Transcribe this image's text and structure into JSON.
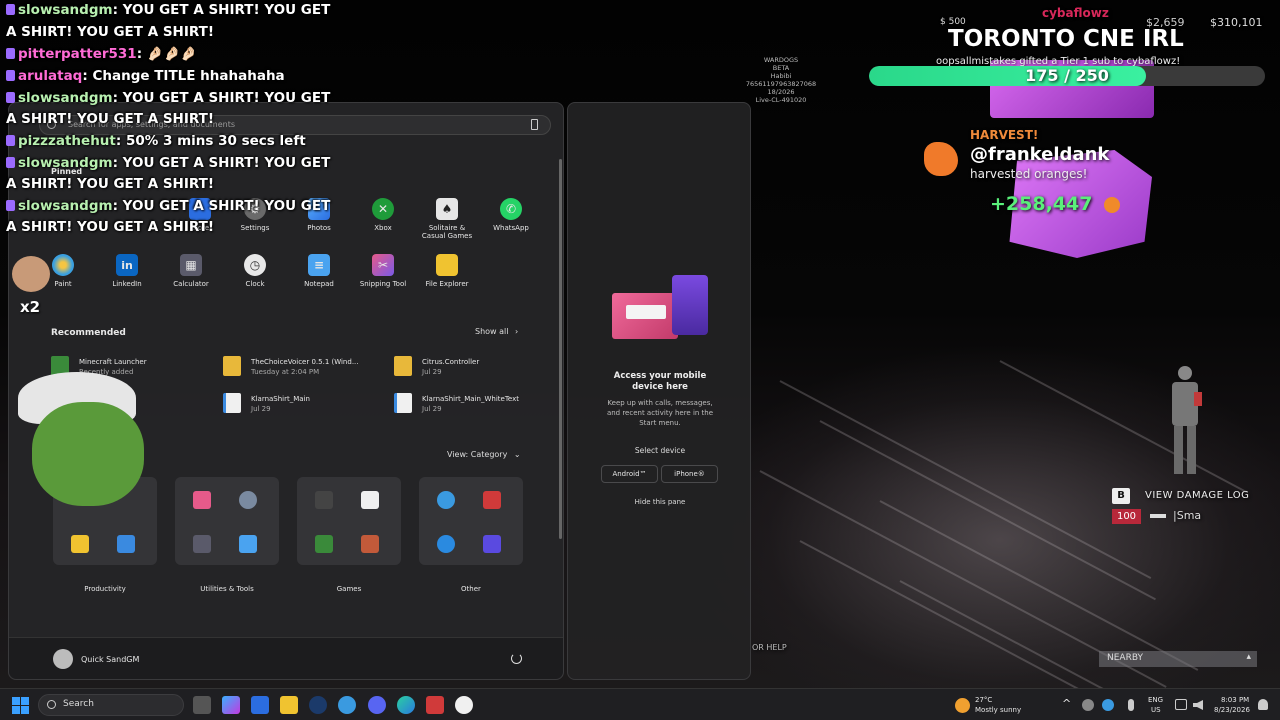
{
  "chat": {
    "messages": [
      {
        "user": "slowsandgm",
        "text": "YOU GET A SHIRT! YOU GET"
      },
      {
        "user": "",
        "text": "A SHIRT! YOU GET A SHIRT!"
      },
      {
        "user": "pitterpatter531",
        "text": "🤌🏻🤌🏻🤌🏻"
      },
      {
        "user": "arulataq",
        "text": "Change TITLE hhahahaha"
      },
      {
        "user": "slowsandgm",
        "text": "YOU GET A SHIRT! YOU GET"
      },
      {
        "user": "",
        "text": "A SHIRT! YOU GET A SHIRT!"
      },
      {
        "user": "pizzzathehut",
        "text": "50% 3 mins 30 secs left"
      },
      {
        "user": "slowsandgm",
        "text": "YOU GET A SHIRT! YOU GET"
      },
      {
        "user": "",
        "text": "A SHIRT! YOU GET A SHIRT!"
      },
      {
        "user": "slowsandgm",
        "text": "YOU GET A SHIRT! YOU GET"
      },
      {
        "user": "",
        "text": "A SHIRT! YOU GET A SHIRT!"
      }
    ],
    "multiplier": "x2"
  },
  "start_menu": {
    "search_placeholder": "Search for apps, settings, and documents",
    "pinned_label": "Pinned",
    "pinned_row1": [
      {
        "label": "Store",
        "color": "#2b6de0"
      },
      {
        "label": "Settings",
        "color": "#7a7a7a"
      },
      {
        "label": "Photos",
        "color": "#3d8de0"
      },
      {
        "label": "Xbox",
        "color": "#1f9b3a"
      },
      {
        "label": "Solitaire & Casual Games",
        "color": "#d8d8d8"
      },
      {
        "label": "WhatsApp",
        "color": "#25d366"
      }
    ],
    "pinned_row2": [
      {
        "label": "Paint",
        "color": "#3aa0e0"
      },
      {
        "label": "LinkedIn",
        "color": "#0a66c2"
      },
      {
        "label": "Calculator",
        "color": "#6a6a7a"
      },
      {
        "label": "Clock",
        "color": "#e0e0e0"
      },
      {
        "label": "Notepad",
        "color": "#4aa3f0"
      },
      {
        "label": "Snipping Tool",
        "color": "#e65a8a"
      },
      {
        "label": "File Explorer",
        "color": "#f0c330"
      }
    ],
    "recommended_label": "Recommended",
    "show_all_label": "Show all",
    "recommended": [
      {
        "title": "Minecraft Launcher",
        "sub": "Recently added",
        "color": "#3a8a3a"
      },
      {
        "title": "TheChoiceVoicer 0.5.1 (Wind...",
        "sub": "Tuesday at 2:04 PM",
        "color": "#e8b83a"
      },
      {
        "title": "Citrus.Controller",
        "sub": "Jul 29",
        "color": "#e8b83a"
      },
      {
        "title": "KlarnaShirt_Main",
        "sub": "Jul 29",
        "color": "#3a8ae0"
      },
      {
        "title": "KlarnaShirt_Main_WhiteText",
        "sub": "Jul 29",
        "color": "#3a8ae0"
      }
    ],
    "view_label": "View: Category",
    "categories": [
      "Productivity",
      "Utilities & Tools",
      "Games",
      "Other"
    ],
    "user_name": "Quick SandGM"
  },
  "phone_panel": {
    "title": "Access your mobile device here",
    "desc": "Keep up with calls, messages, and recent activity here in the Start menu.",
    "select_device": "Select device",
    "android": "Android™",
    "iphone": "iPhone®",
    "hide": "Hide this pane"
  },
  "game_overlay": {
    "build_info": [
      "WARDOGS",
      "BETA",
      "Habibi",
      "76561197963827068",
      "18/2026",
      "Live-CL-491020"
    ],
    "cash_left": "$ 500",
    "cash_mid": "$2,659",
    "cash_right": "$310,101",
    "stream_title": "TORONTO CNE IRL",
    "sub_alert": "oopsallmistakes gifted a Tier 1 sub to cybaflowz!",
    "alert_user": "cybaflowz",
    "goal_progress": "175 / 250",
    "goal_fraction": 0.7,
    "harvest_label": "HARVEST!",
    "harvest_user": "@frankeldank",
    "harvest_text": "harvested oranges!",
    "harvest_amount": "+258,447",
    "damage_key": "B",
    "damage_log": "VIEW DAMAGE LOG",
    "health": "100",
    "weapon": "|Sma",
    "help_text": "OR HELP",
    "nearby": "NEARBY"
  },
  "taskbar": {
    "search_label": "Search",
    "weather_temp": "27°C",
    "weather_desc": "Mostly sunny",
    "lang_top": "ENG",
    "lang_bottom": "US",
    "time": "8:03 PM",
    "date": "8/23/2026"
  }
}
